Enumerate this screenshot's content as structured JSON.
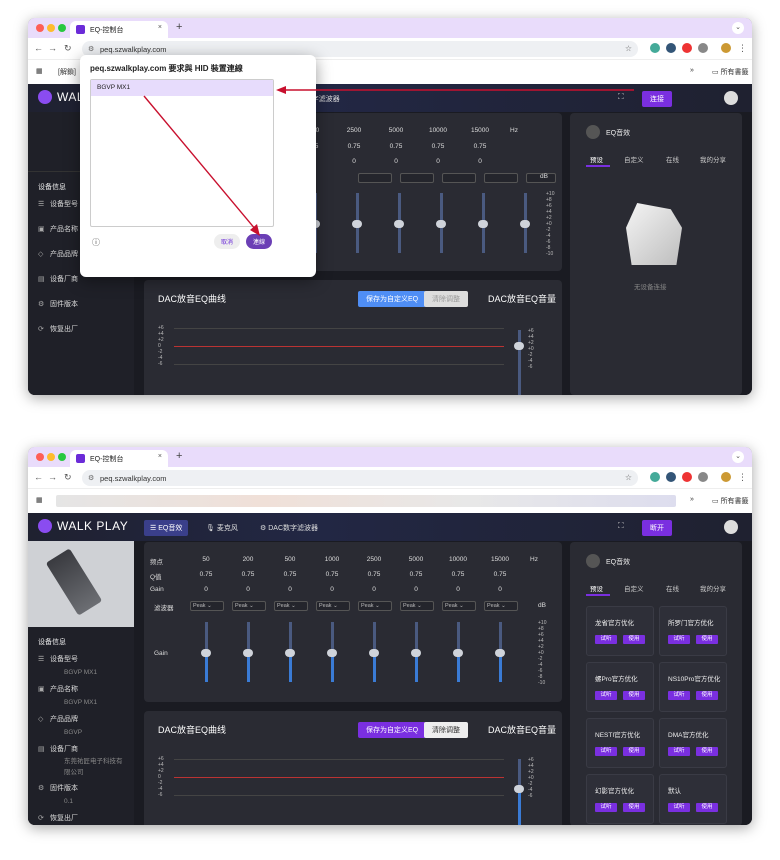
{
  "tab_title": "EQ-控制台",
  "url": "peq.szwalkplay.com",
  "bookmark_all": "所有書籤",
  "bookmark_first": "[解鎖]",
  "logo": "WALK PLAY",
  "header_tabs": [
    "EQ音效",
    "麦克风",
    "DAC数字滤波器"
  ],
  "connect_label": "连接",
  "disconnect_label": "断开",
  "popup": {
    "title": "peq.szwalkplay.com 要求與 HID 裝置連線",
    "device": "BGVP MX1",
    "cancel": "取消",
    "connect": "連線"
  },
  "sidebar": {
    "header": "设备信息",
    "items": [
      {
        "label": "设备型号",
        "value": "BGVP MX1"
      },
      {
        "label": "产品名称",
        "value": "BGVP MX1"
      },
      {
        "label": "产品品牌",
        "value": "BGVP"
      },
      {
        "label": "设备厂商",
        "value": "东莞祐匠电子科技有限公司"
      },
      {
        "label": "固件版本",
        "value": "0.1"
      },
      {
        "label": "恢复出厂",
        "value": ""
      }
    ]
  },
  "eq": {
    "freq_label": "频点",
    "q_label": "Q值",
    "gain_label": "Gain",
    "filter_label": "滤波器",
    "hz": "Hz",
    "db": "dB",
    "slider_label": "Gain",
    "freqs": [
      "50",
      "200",
      "500",
      "1000",
      "2500",
      "5000",
      "10000",
      "15000"
    ],
    "q": [
      "0.75",
      "0.75",
      "0.75",
      "0.75",
      "0.75",
      "0.75",
      "0.75",
      "0.75"
    ],
    "gain": [
      "0",
      "0",
      "0",
      "0",
      "0",
      "0",
      "0",
      "0"
    ],
    "filter": "Peak",
    "scale": [
      "+10",
      "+8",
      "+6",
      "+4",
      "+2",
      "+0",
      "-2",
      "-4",
      "-6",
      "-8",
      "-10"
    ]
  },
  "dac": {
    "title": "DAC放音EQ曲线",
    "save": "保存为自定义EQ",
    "clear": "清除调整",
    "vol_title": "DAC放音EQ音量",
    "y": [
      "+6",
      "+4",
      "+2",
      "0",
      "-2",
      "-4",
      "-6"
    ],
    "vol_scale": [
      "+6",
      "+4",
      "+2",
      "+0",
      "-2",
      "-4",
      "-6"
    ]
  },
  "right": {
    "title": "EQ音效",
    "tabs": [
      "预设",
      "自定义",
      "在线",
      "我的分享"
    ],
    "empty": "无设备连接",
    "presets": [
      "龙省官方优化",
      "所罗门官方优化",
      "螺Pro官方优化",
      "NS10Pro官方优化",
      "NESTI官方优化",
      "DMA官方优化",
      "幻影官方优化",
      "默认"
    ],
    "try": "试听",
    "use": "使用"
  },
  "colors": {
    "accent": "#7a2fe0",
    "bg": "#1a1b22",
    "arrow": "#c8102e"
  }
}
